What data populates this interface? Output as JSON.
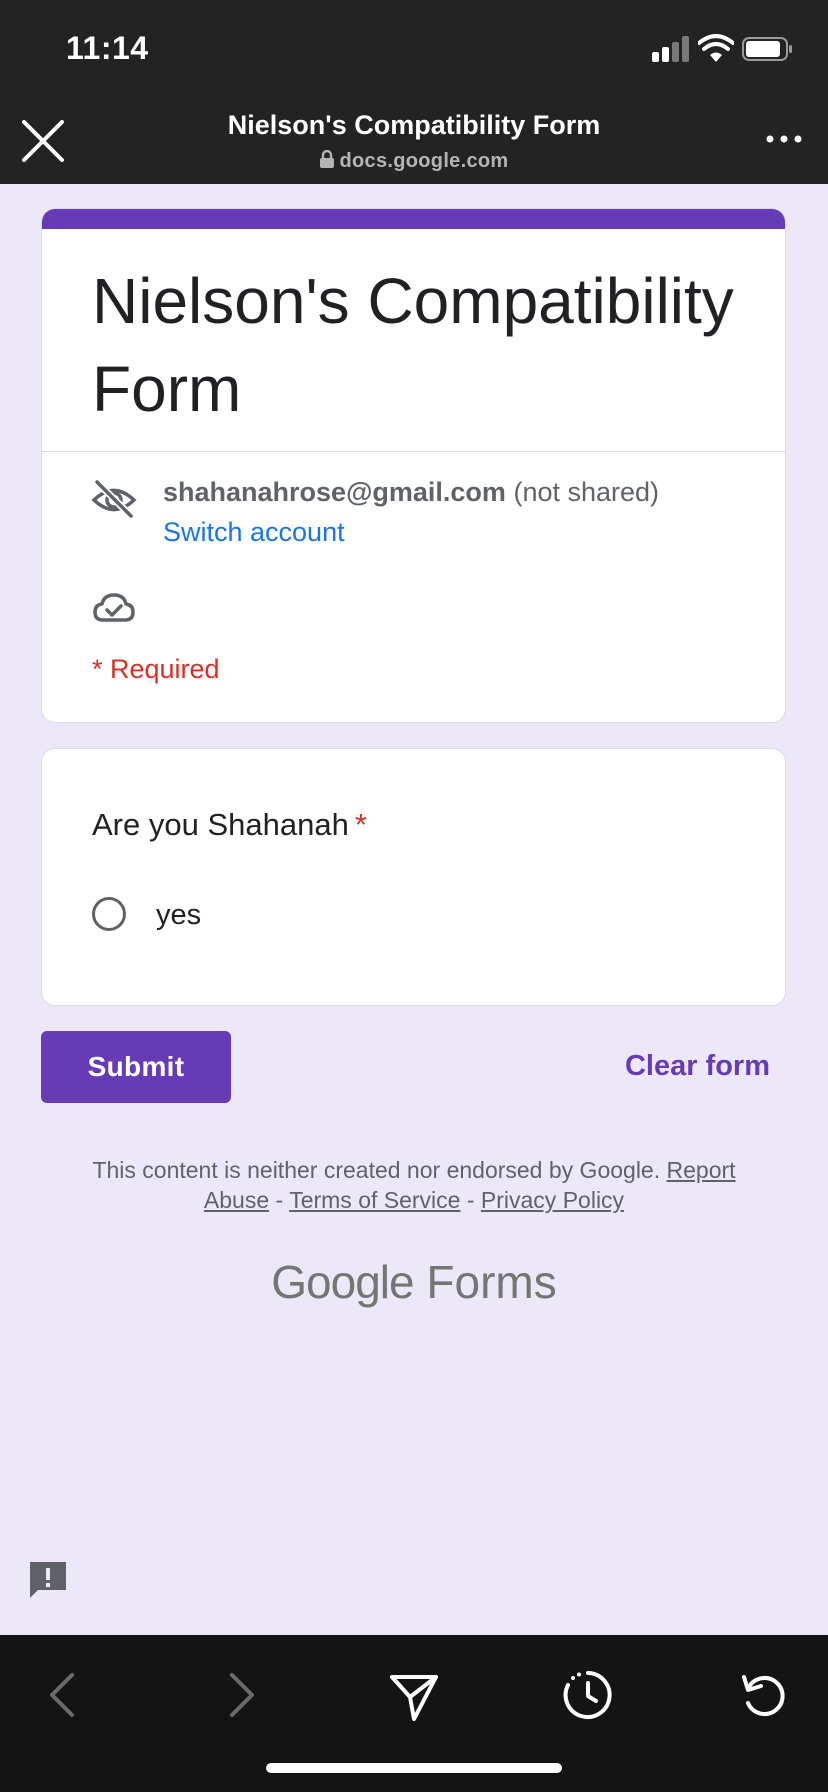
{
  "status_bar": {
    "time": "11:14"
  },
  "nav": {
    "title": "Nielson's Compatibility Form",
    "url": "docs.google.com"
  },
  "form": {
    "title": "Nielson's Compatibility Form",
    "account_email": "shahanahrose@gmail.com",
    "account_suffix": "(not shared)",
    "switch_account": "Switch account",
    "required_note": "* Required",
    "accent_color": "#673ab7"
  },
  "question": {
    "text": "Are you Shahanah",
    "required_marker": "*",
    "options": [
      "yes"
    ]
  },
  "actions": {
    "submit": "Submit",
    "clear": "Clear form"
  },
  "footer": {
    "disclaimer": "This content is neither created nor endorsed by Google.",
    "report_abuse": "Report Abuse",
    "sep": "-",
    "terms": "Terms of Service",
    "privacy": "Privacy Policy",
    "brand_google": "Google",
    "brand_forms": "Forms"
  }
}
